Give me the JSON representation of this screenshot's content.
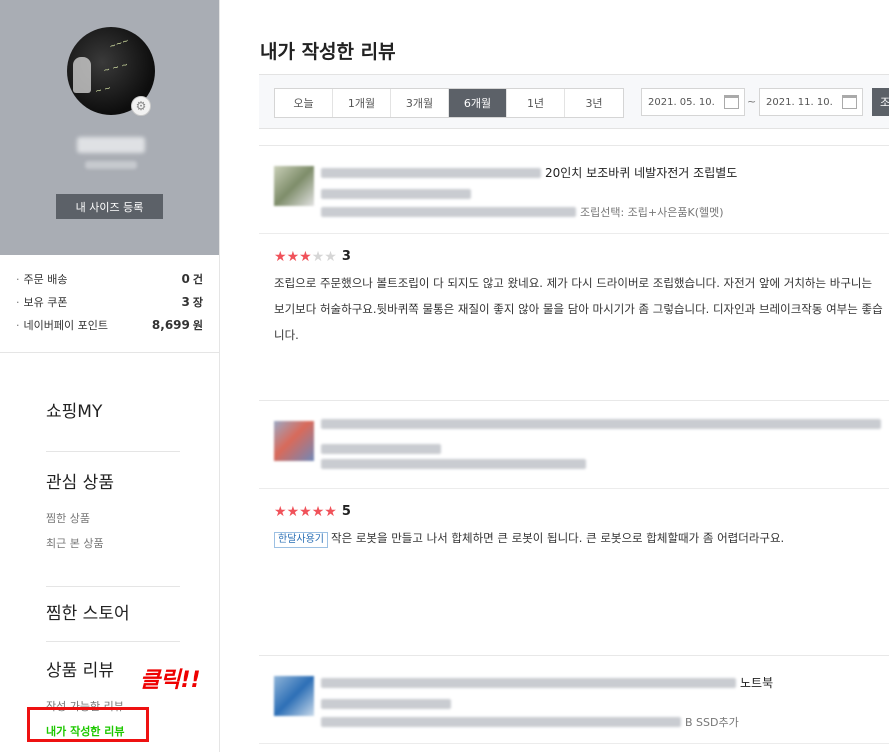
{
  "sidebar": {
    "size_button": "내 사이즈 등록",
    "stats": [
      {
        "label": "주문 배송",
        "value": "0",
        "unit": "건"
      },
      {
        "label": "보유 쿠폰",
        "value": "3",
        "unit": "장"
      },
      {
        "label": "네이버페이 포인트",
        "value": "8,699",
        "unit": "원"
      }
    ],
    "menu": {
      "shopping_my": "쇼핑MY",
      "interest": "관심 상품",
      "interest_items": [
        "찜한 상품",
        "최근 본 상품"
      ],
      "favorite_store": "찜한 스토어",
      "review": "상품 리뷰",
      "review_items": [
        "작성 가능한 리뷰",
        "내가 작성한 리뷰"
      ]
    },
    "annotation": "클릭!!"
  },
  "main": {
    "title": "내가 작성한 리뷰",
    "periods": [
      "오늘",
      "1개월",
      "3개월",
      "6개월",
      "1년",
      "3년"
    ],
    "selected_period": "6개월",
    "date_from": "2021. 05. 10.",
    "date_to": "2021. 11. 10.",
    "tilde": "~",
    "search_button": "조"
  },
  "reviews": [
    {
      "product_name_visible": "20인치 보조바퀴 네발자전거 조립별도",
      "option_visible": "조립선택: 조립+사은품K(헬멧)",
      "rating": 3,
      "score_label": "3",
      "text": "조립으로 주문했으나 볼트조립이 다 되지도 않고 왔네요. 제가 다시 드라이버로 조립했습니다. 자전거 앞에 거치하는 바구니는 보기보다 허술하구요.뒷바퀴쪽 물통은 재질이 좋지 않아 물을 담아 마시기가 좀 그렇습니다. 디자인과 브레이크작동 여부는 좋습니다."
    },
    {
      "rating": 5,
      "score_label": "5",
      "tag": "한달사용기",
      "text": "작은 로봇을 만들고 나서 합체하면 큰 로봇이 됩니다. 큰 로봇으로 합체할때가 좀 어렵더라구요."
    },
    {
      "product_name_visible": "노트북",
      "option_visible": "B SSD추가"
    }
  ],
  "colors": {
    "accent_green": "#1ec800",
    "star_red": "#f0525a",
    "annotation_red": "#ee1111",
    "button_dark": "#5c6168"
  }
}
